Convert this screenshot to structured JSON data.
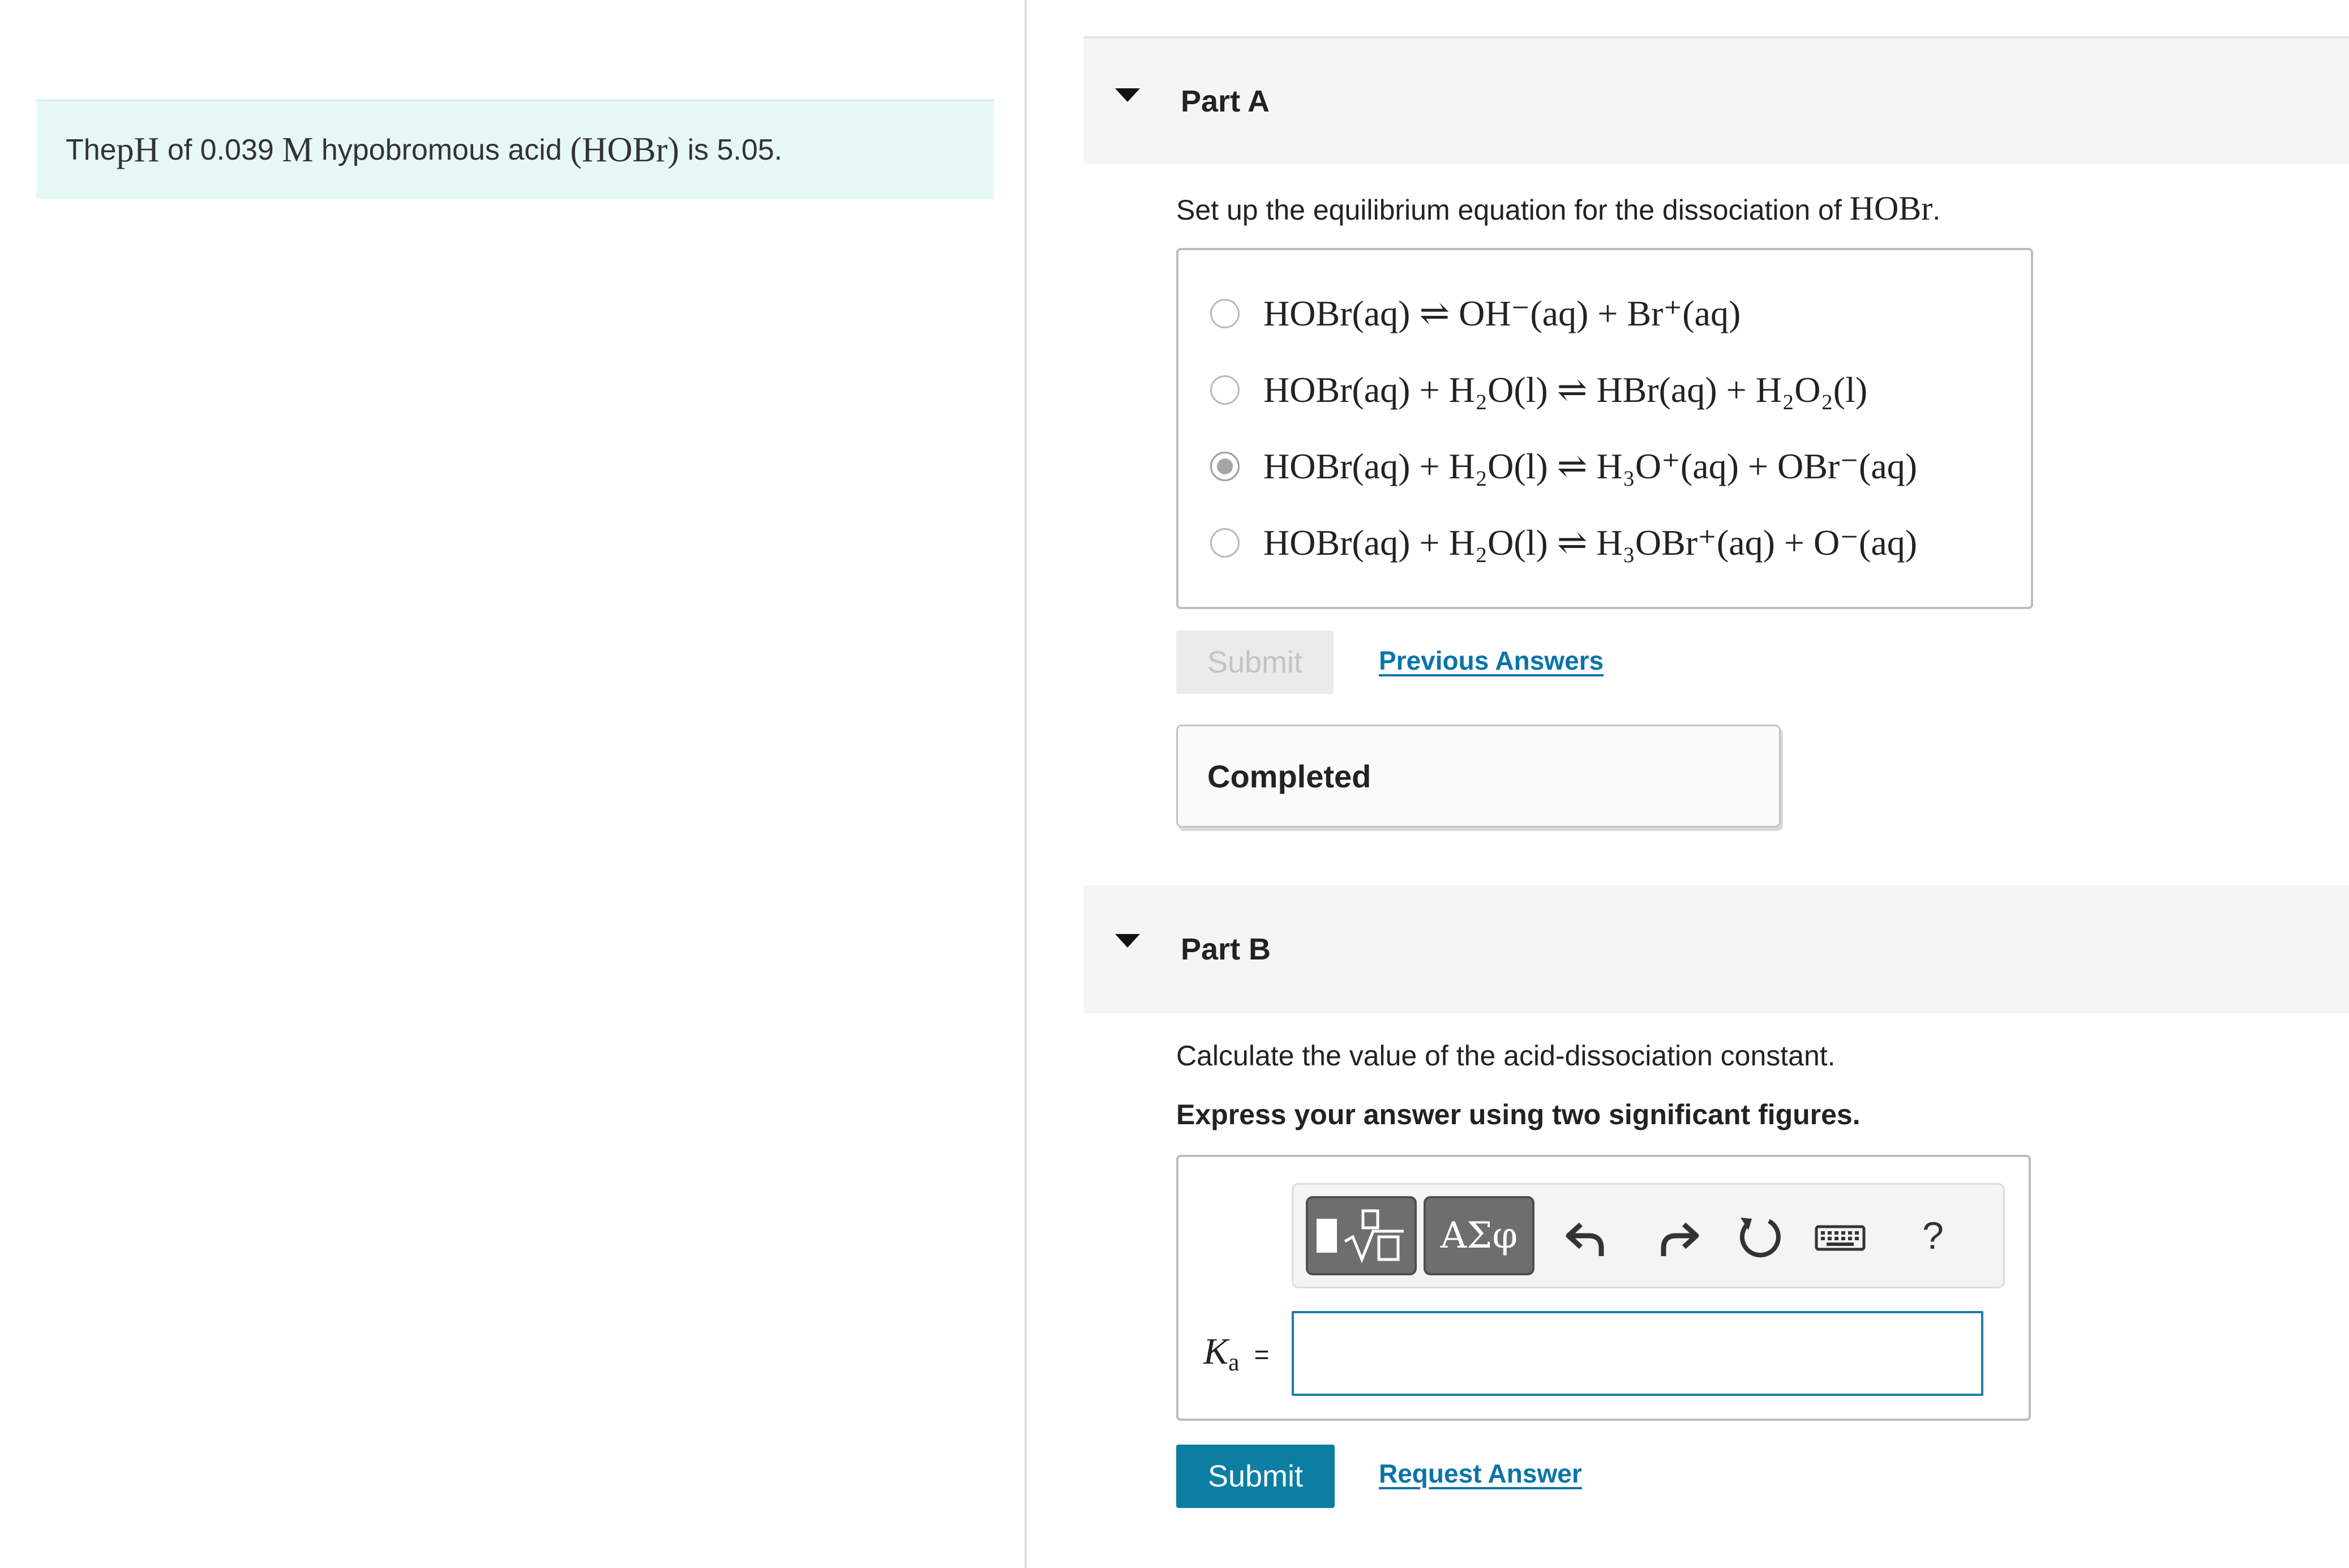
{
  "problem": {
    "text_before_ph": "The ",
    "ph_symbol": "pH",
    "text_of": " of 0.039 ",
    "molar_unit": "M",
    "text_acid": " hypobromous acid ",
    "formula": "(HOBr)",
    "text_value": " is 5.05."
  },
  "part_a": {
    "title": "Part A",
    "prompt_text": "Set up the equilibrium equation for the dissociation of ",
    "prompt_formula": "HOBr",
    "prompt_end": ".",
    "choices": [
      {
        "eq": "HOBr(aq) ⇌ OH⁻(aq) + Br⁺(aq)",
        "selected": false
      },
      {
        "eq": "HOBr(aq) + H₂O(l) ⇌ HBr(aq) + H₂O₂(l)",
        "selected": false
      },
      {
        "eq": "HOBr(aq) + H₂O(l) ⇌ H₃O⁺(aq) + OBr⁻(aq)",
        "selected": true
      },
      {
        "eq": "HOBr(aq) + H₂O(l) ⇌ H₃OBr⁺(aq) + O⁻(aq)",
        "selected": false
      }
    ],
    "submit_label": "Submit",
    "previous_answers_label": "Previous Answers",
    "completed_label": "Completed"
  },
  "part_b": {
    "title": "Part B",
    "prompt_text": "Calculate the value of the acid-dissociation constant.",
    "instruction_text": "Express your answer using two significant figures.",
    "toolbar": {
      "symbols_label": "ΑΣφ",
      "help_label": "?"
    },
    "ka_symbol": "K",
    "ka_subscript": "a",
    "ka_equals": "=",
    "answer_value": "",
    "submit_label": "Submit",
    "request_answer_label": "Request Answer"
  },
  "colors": {
    "problem_bg": "#e6f7f6",
    "link": "#0a74a8",
    "submit_bg": "#0d7ea3",
    "input_border": "#1c7ea8"
  },
  "icons": [
    "caret-down-icon",
    "template-icon",
    "undo-icon",
    "redo-icon",
    "reset-icon",
    "keyboard-icon",
    "help-icon"
  ]
}
